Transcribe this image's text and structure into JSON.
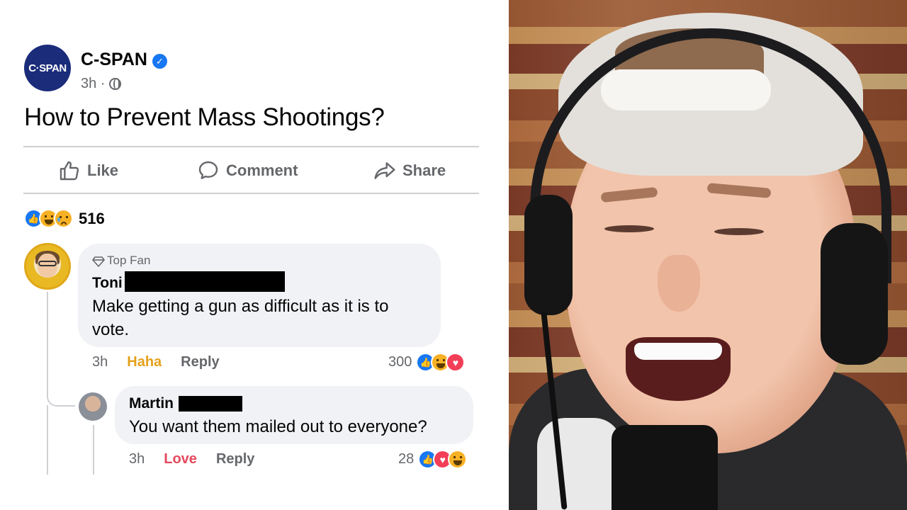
{
  "post": {
    "page_avatar_text": "C·SPAN",
    "page_name": "C-SPAN",
    "time": "3h ·",
    "text": "How to Prevent Mass Shootings?",
    "actions": {
      "like": "Like",
      "comment": "Comment",
      "share": "Share"
    },
    "reaction_icons": [
      "like-icon",
      "haha-icon",
      "sad-icon"
    ],
    "reaction_count": "516"
  },
  "comments": [
    {
      "badge": "Top Fan",
      "author": "Toni",
      "text_line1": "Make getting a gun as difficult as it is to",
      "text_line2": "vote.",
      "time": "3h",
      "reaction_label": "Haha",
      "reply_label": "Reply",
      "reaction_count": "300",
      "reaction_icons": [
        "like-icon",
        "haha-icon",
        "love-icon"
      ]
    },
    {
      "author": "Martin",
      "text": "You want them mailed out to everyone?",
      "time": "3h",
      "reaction_label": "Love",
      "reply_label": "Reply",
      "reaction_count": "28",
      "reaction_icons": [
        "like-icon",
        "love-icon",
        "haha-icon"
      ]
    }
  ],
  "colors": {
    "facebook_blue": "#1877f2",
    "cspan_navy": "#1a2c7a",
    "meta_gray": "#65676b",
    "bubble_gray": "#f0f2f5",
    "haha_yellow": "#e4a11b",
    "love_red": "#e4485b"
  }
}
